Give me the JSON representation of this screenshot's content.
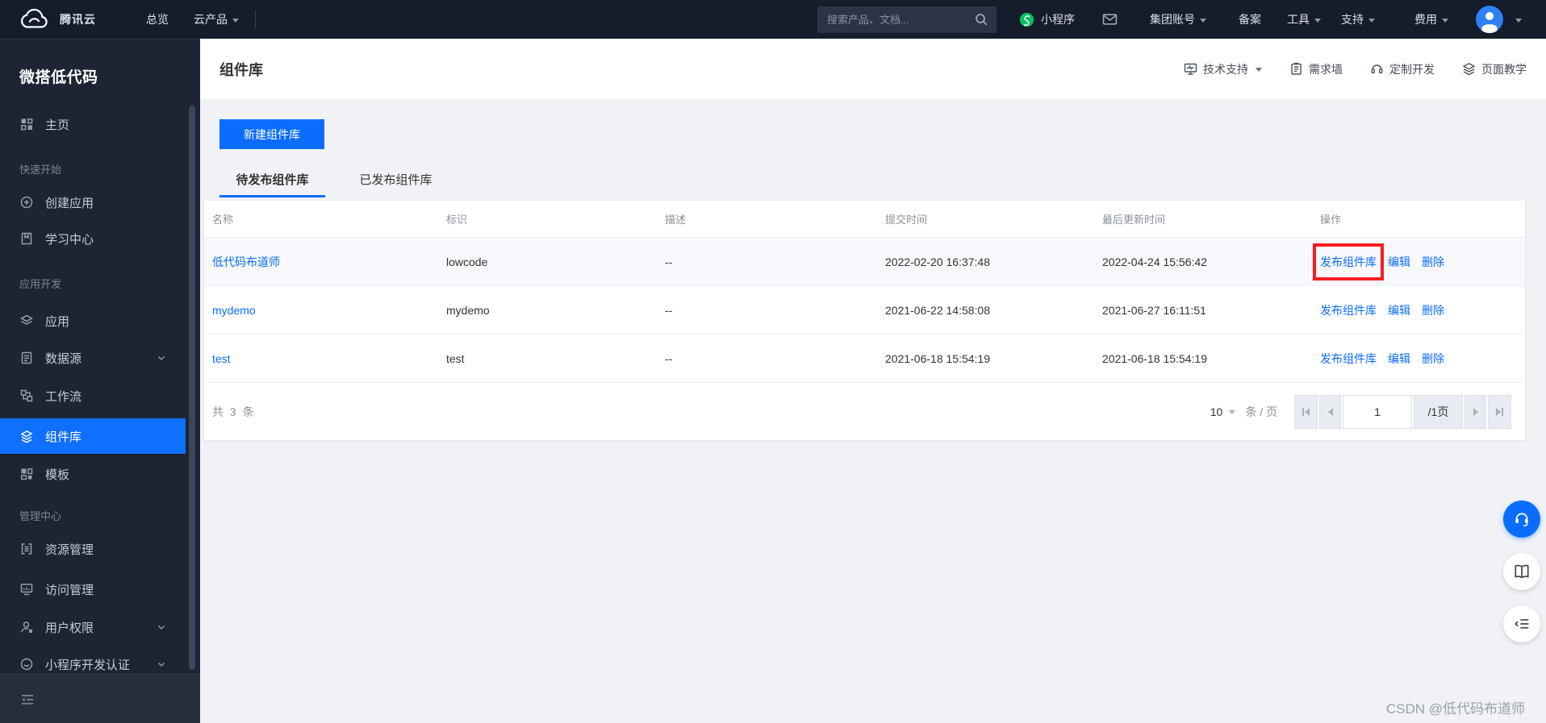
{
  "topbar": {
    "logo_text": "腾讯云",
    "nav": [
      {
        "label": "总览"
      },
      {
        "label": "云产品"
      }
    ],
    "search_placeholder": "搜索产品、文档...",
    "mini_program_label": "小程序",
    "menu": [
      {
        "label": "集团账号"
      },
      {
        "label": "备案"
      },
      {
        "label": "工具"
      },
      {
        "label": "支持"
      },
      {
        "label": "费用"
      }
    ]
  },
  "sidebar": {
    "title": "微搭低代码",
    "home_label": "主页",
    "groups": [
      {
        "label": "快速开始",
        "items": [
          {
            "label": "创建应用"
          },
          {
            "label": "学习中心"
          }
        ]
      },
      {
        "label": "应用开发",
        "items": [
          {
            "label": "应用"
          },
          {
            "label": "数据源"
          },
          {
            "label": "工作流"
          },
          {
            "label": "组件库"
          },
          {
            "label": "模板"
          }
        ]
      },
      {
        "label": "管理中心",
        "items": [
          {
            "label": "资源管理"
          },
          {
            "label": "访问管理"
          },
          {
            "label": "用户权限"
          },
          {
            "label": "小程序开发认证"
          }
        ]
      }
    ]
  },
  "page": {
    "title": "组件库",
    "actions": [
      {
        "label": "技术支持"
      },
      {
        "label": "需求墙"
      },
      {
        "label": "定制开发"
      },
      {
        "label": "页面教学"
      }
    ],
    "new_button": "新建组件库",
    "tabs": [
      {
        "label": "待发布组件库",
        "active": true
      },
      {
        "label": "已发布组件库",
        "active": false
      }
    ]
  },
  "table": {
    "columns": [
      "名称",
      "标识",
      "描述",
      "提交时间",
      "最后更新时间",
      "操作"
    ],
    "rows": [
      {
        "name": "低代码布道师",
        "identifier": "lowcode",
        "description": "--",
        "submit_time": "2022-02-20 16:37:48",
        "update_time": "2022-04-24 15:56:42",
        "actions": [
          "发布组件库",
          "编辑",
          "删除"
        ]
      },
      {
        "name": "mydemo",
        "identifier": "mydemo",
        "description": "--",
        "submit_time": "2021-06-22 14:58:08",
        "update_time": "2021-06-27 16:11:51",
        "actions": [
          "发布组件库",
          "编辑",
          "删除"
        ]
      },
      {
        "name": "test",
        "identifier": "test",
        "description": "--",
        "submit_time": "2021-06-18 15:54:19",
        "update_time": "2021-06-18 15:54:19",
        "actions": [
          "发布组件库",
          "编辑",
          "删除"
        ]
      }
    ]
  },
  "pagination": {
    "total": "共 3 条",
    "page_size": "10",
    "unit": "条 / 页",
    "current_page": "1",
    "total_pages": "/1页"
  },
  "watermark": "CSDN @低代码布道师",
  "colors": {
    "accent": "#0a6dff",
    "sidebar_selected": "#0f6fff",
    "highlight_red": "#f81d22",
    "link_blue": "#0a6cff",
    "mini_program_green": "#07c160"
  }
}
